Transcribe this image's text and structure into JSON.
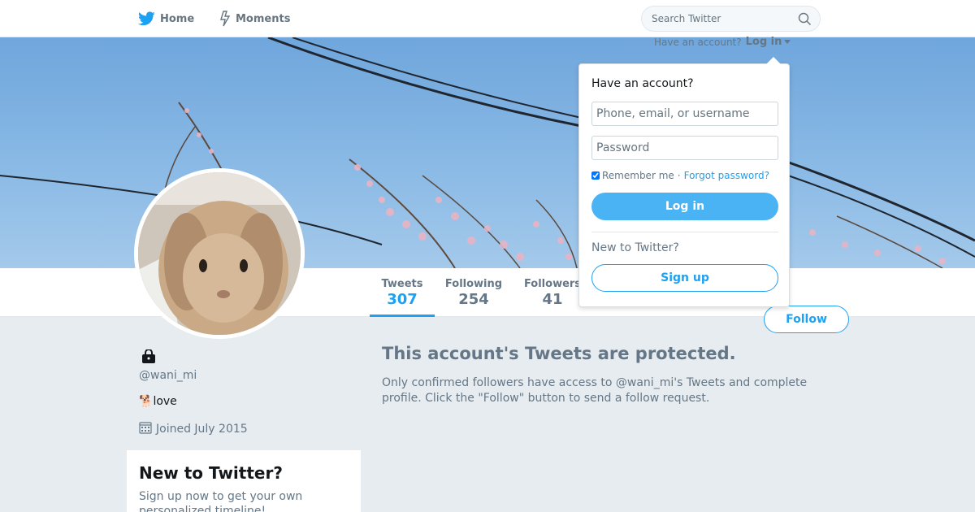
{
  "nav": {
    "home_label": "Home",
    "moments_label": "Moments",
    "search_placeholder": "Search Twitter"
  },
  "header": {
    "have_account": "Have an account?",
    "login_link": "Log in"
  },
  "stats": [
    {
      "label": "Tweets",
      "value": "307"
    },
    {
      "label": "Following",
      "value": "254"
    },
    {
      "label": "Followers",
      "value": "41"
    }
  ],
  "follow_button": "Follow",
  "profile": {
    "handle": "@wani_mi",
    "bio_emoji": "🐕",
    "bio_text": "love",
    "joined": "Joined July 2015"
  },
  "signup_card": {
    "title": "New to Twitter?",
    "text": "Sign up now to get your own personalized timeline!"
  },
  "protected": {
    "title": "This account's Tweets are protected.",
    "body": "Only confirmed followers have access to @wani_mi's Tweets and complete profile. Click the \"Follow\" button to send a follow request."
  },
  "login_dropdown": {
    "title": "Have an account?",
    "username_placeholder": "Phone, email, or username",
    "password_placeholder": "Password",
    "remember_me": "Remember me",
    "separator": "·",
    "forgot_password": "Forgot password?",
    "login_button": "Log in",
    "new_to_twitter": "New to Twitter?",
    "signup_button": "Sign up"
  },
  "colors": {
    "accent": "#1da1f2",
    "login_button_bg": "#4ab3f4",
    "page_bg": "#e6ecf0",
    "muted_text": "#657786"
  },
  "icons": [
    "twitter-bird-icon",
    "moments-bolt-icon",
    "search-icon",
    "lock-icon",
    "calendar-icon",
    "caret-down-icon"
  ]
}
